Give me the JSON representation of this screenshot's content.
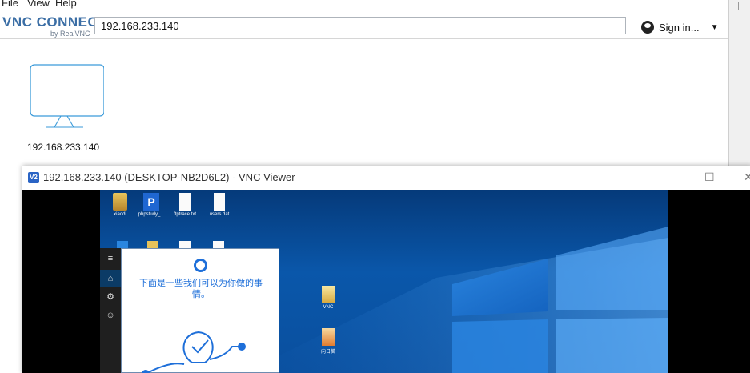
{
  "menu": {
    "items": [
      "File",
      "View",
      "Help"
    ]
  },
  "connect": {
    "logo_main": "VNC CONNECT",
    "logo_sub": "by RealVNC",
    "address_value": "192.168.233.140",
    "signin_label": "Sign in...",
    "address_book_label": "192.168.233.140"
  },
  "viewer": {
    "icon_text": "V2",
    "title": "192.168.233.140 (DESKTOP-NB2D6L2) - VNC Viewer",
    "minimize": "—",
    "maximize": "☐",
    "close": "✕"
  },
  "desktop": {
    "icons": [
      {
        "label": "xiaodi"
      },
      {
        "label": "phpstudy_..."
      },
      {
        "label": "ftptrace.txt"
      },
      {
        "label": "users.dat"
      },
      {
        "label": "VNC"
      },
      {
        "label": "向日葵"
      }
    ],
    "cortana_message": "下面是一些我们可以为你做的事情。",
    "rail_icons": [
      "hamburger-icon",
      "home-icon",
      "settings-icon",
      "feedback-icon"
    ]
  },
  "colors": {
    "accent": "#1e6fd9",
    "logo": "#3b6ea5",
    "desktop_bg": "#0a57aa"
  }
}
